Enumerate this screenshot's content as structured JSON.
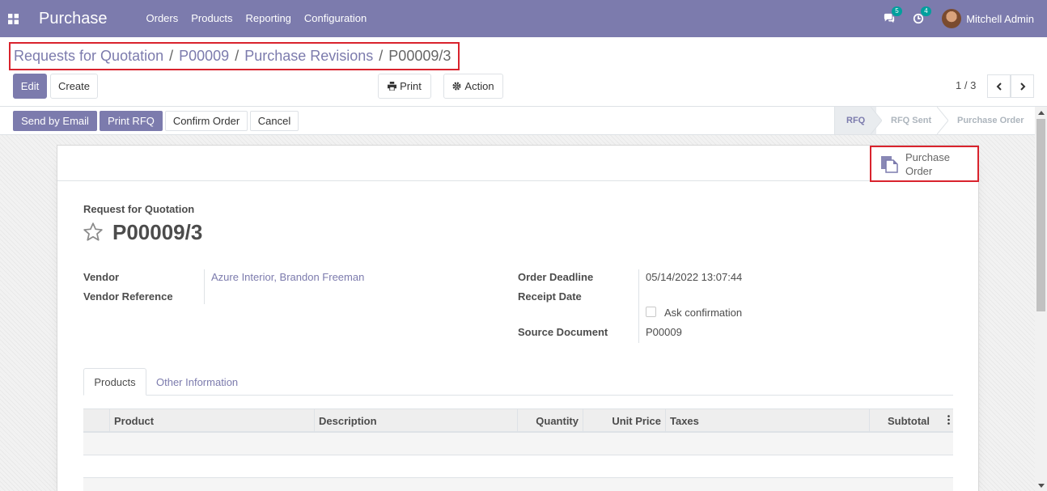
{
  "navbar": {
    "brand": "Purchase",
    "menu": [
      "Orders",
      "Products",
      "Reporting",
      "Configuration"
    ],
    "messages_count": "5",
    "activities_count": "4",
    "user_name": "Mitchell Admin"
  },
  "breadcrumb": [
    "Requests for Quotation",
    "P00009",
    "Purchase Revisions",
    "P00009/3"
  ],
  "toolbar": {
    "edit_label": "Edit",
    "create_label": "Create",
    "print_label": "Print",
    "action_label": "Action",
    "pager_value": "1 / 3"
  },
  "statusbar": {
    "buttons": [
      "Send by Email",
      "Print RFQ",
      "Confirm Order",
      "Cancel"
    ],
    "stages": [
      "RFQ",
      "RFQ Sent",
      "Purchase Order"
    ],
    "current_stage": "RFQ"
  },
  "smart_button": {
    "line1": "Purchase",
    "line2": "Order"
  },
  "form": {
    "subtitle": "Request for Quotation",
    "title": "P00009/3",
    "vendor_label": "Vendor",
    "vendor_value": "Azure Interior, Brandon Freeman",
    "vendor_ref_label": "Vendor Reference",
    "vendor_ref_value": "",
    "order_deadline_label": "Order Deadline",
    "order_deadline_value": "05/14/2022 13:07:44",
    "receipt_date_label": "Receipt Date",
    "ask_confirmation_label": "Ask confirmation",
    "ask_confirmation_checked": false,
    "source_document_label": "Source Document",
    "source_document_value": "P00009"
  },
  "tabs": [
    "Products",
    "Other Information"
  ],
  "table": {
    "columns": [
      "Product",
      "Description",
      "Quantity",
      "Unit Price",
      "Taxes",
      "Subtotal"
    ]
  },
  "colors": {
    "brand": "#7c7bad",
    "highlight_border": "#d9232d"
  }
}
